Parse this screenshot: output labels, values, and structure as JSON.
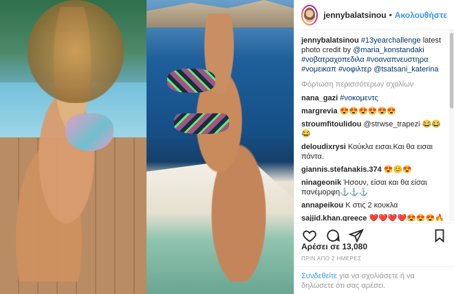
{
  "post": {
    "username": "jennybalatsinou",
    "separator": "•",
    "follow_label": "Ακολουθήστε",
    "caption_user": "jennybalatsinou",
    "caption_parts": [
      {
        "text": " ",
        "type": "text"
      },
      {
        "text": "#13yearchallenge",
        "type": "tag"
      },
      {
        "text": " latest photo credit by ",
        "type": "text"
      },
      {
        "text": "@maria_konstandaki",
        "type": "tag"
      },
      {
        "text": " ",
        "type": "text"
      },
      {
        "text": "#νοβατραχοπεδιλα",
        "type": "tag"
      },
      {
        "text": " ",
        "type": "text"
      },
      {
        "text": "#νοαναπνευστηρα",
        "type": "tag"
      },
      {
        "text": " ",
        "type": "text"
      },
      {
        "text": "#νομεικαπ",
        "type": "tag"
      },
      {
        "text": " ",
        "type": "text"
      },
      {
        "text": "#νοφιλτερ",
        "type": "tag"
      },
      {
        "text": " ",
        "type": "text"
      },
      {
        "text": "@tsatsani_katerina",
        "type": "tag"
      }
    ],
    "load_more_label": "Φόρτωση περισσότερων σχολίων",
    "comments": [
      {
        "user": "nana_gazi",
        "text": "#νοκομεντς",
        "tag": true
      },
      {
        "user": "margrevia",
        "text": "😍😍😍😍😍😍",
        "tag": false
      },
      {
        "user": "stroumfitoulidou",
        "text": "@strwse_trapezi 😂😂😂",
        "tag": false
      },
      {
        "user": "deloudixrysi",
        "text": "Κούκλα εισαι.Και θα εισαι πάντα.",
        "tag": false
      },
      {
        "user": "giannis.stefanakis.374",
        "text": "😍😊😍",
        "tag": false
      },
      {
        "user": "ninageonik",
        "text": "Ήσουν, είσαι και θα είσαι πανέμορφη⚓⚓⚓",
        "tag": false
      },
      {
        "user": "annapeikou",
        "text": "Κ στις 2 κουκλα",
        "tag": false
      },
      {
        "user": "sajjid.khan.greece",
        "text": "❤️❤️❤️❤️😍😍😍🔥🔥🔥❤️😍",
        "tag": false
      }
    ],
    "likes_label": "Αρέσει σε 13,080",
    "timestamp": "ΠΡΙΝ ΑΠΟ 2 ΗΜΕΡΕΣ",
    "login_link": "Συνδεθείτε",
    "login_text": " για να σχολιάσετε ή να δηλώσετε ότι σας αρέσει."
  },
  "icons": {
    "like": "heart-icon",
    "comment": "speech-bubble-icon",
    "share": "share-icon",
    "save": "bookmark-icon"
  },
  "colors": {
    "link": "#3897f0",
    "tag": "#003569",
    "muted": "#999999"
  }
}
